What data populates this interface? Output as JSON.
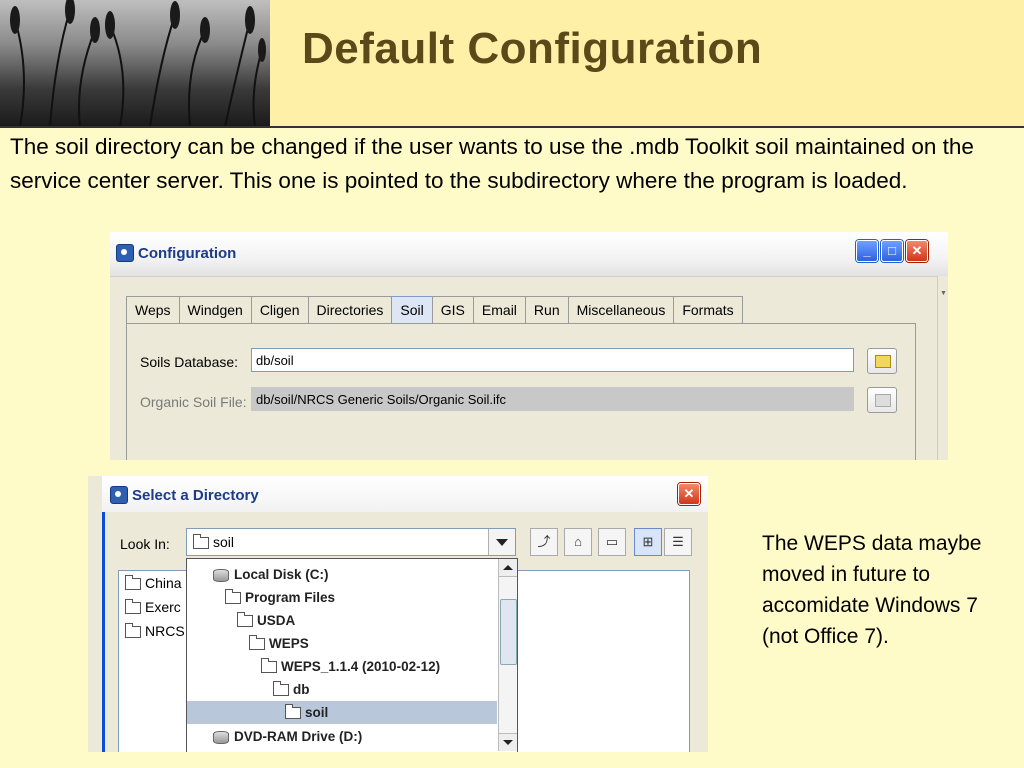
{
  "slide": {
    "title": "Default Configuration",
    "body": "The soil directory can be changed if the user wants to use the .mdb Toolkit soil maintained on the service center server.  This one is pointed to the subdirectory where the program is loaded.",
    "side_note": "The WEPS data maybe moved in future to accomidate Windows 7 (not Office 7)."
  },
  "config_window": {
    "title": "Configuration",
    "tabs": [
      "Weps",
      "Windgen",
      "Cligen",
      "Directories",
      "Soil",
      "GIS",
      "Email",
      "Run",
      "Miscellaneous",
      "Formats"
    ],
    "active_tab": "Soil",
    "soils_db_label": "Soils Database:",
    "soils_db_value": "db/soil",
    "organic_label": "Organic Soil File:",
    "organic_value": "db/soil/NRCS Generic Soils/Organic Soil.ifc"
  },
  "dir_window": {
    "title": "Select a Directory",
    "look_in_label": "Look In:",
    "look_in_value": "soil",
    "file_list": [
      "China",
      "Exerc",
      "NRCS"
    ],
    "dropdown": [
      {
        "label": "Local Disk (C:)",
        "icon": "disk-icon"
      },
      {
        "label": "Program Files",
        "icon": "folder-icon"
      },
      {
        "label": "USDA",
        "icon": "folder-icon"
      },
      {
        "label": "WEPS",
        "icon": "folder-icon"
      },
      {
        "label": "WEPS_1.1.4 (2010-02-12)",
        "icon": "folder-icon"
      },
      {
        "label": "db",
        "icon": "folder-icon"
      },
      {
        "label": "soil",
        "icon": "folder-icon"
      },
      {
        "label": "DVD-RAM Drive (D:)",
        "icon": "disk-icon"
      }
    ],
    "selected": "soil"
  }
}
